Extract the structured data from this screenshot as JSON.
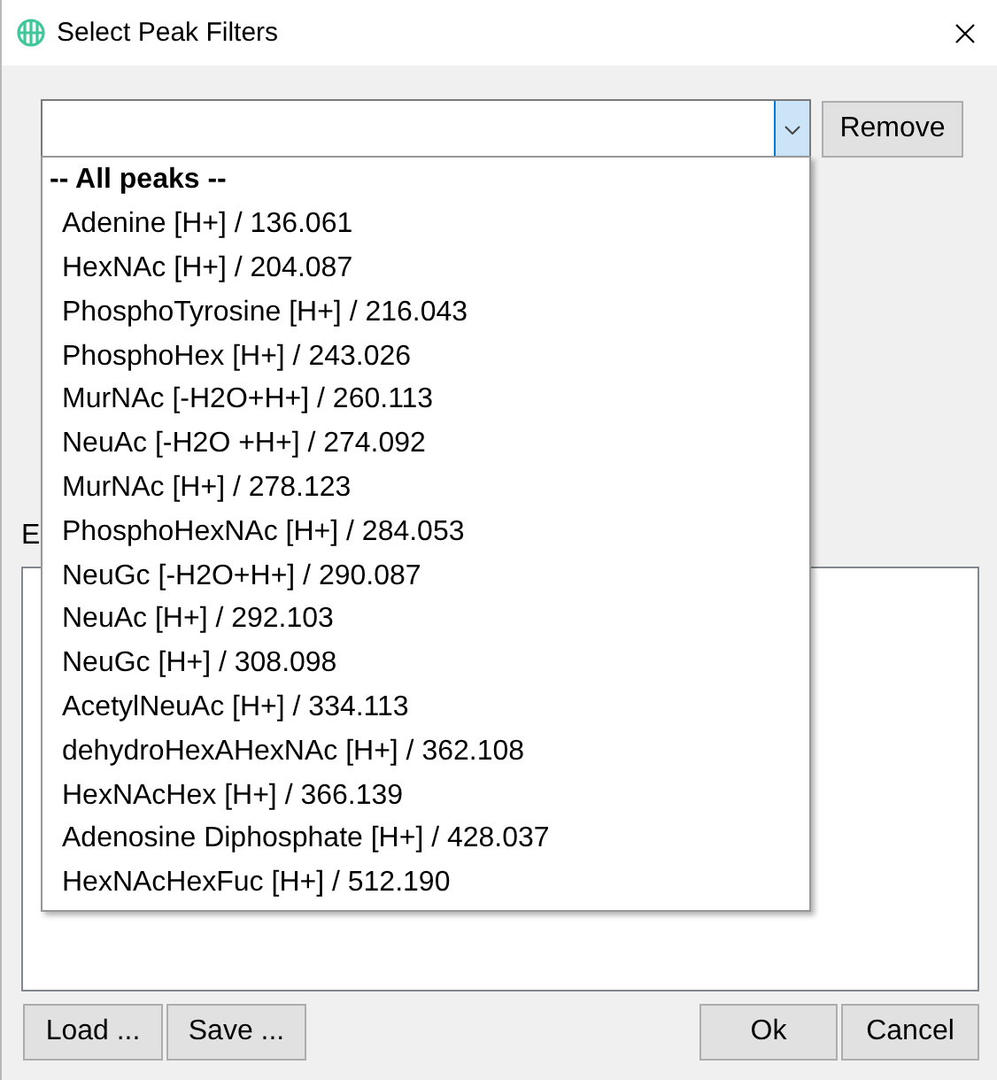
{
  "window": {
    "title": "Select Peak Filters"
  },
  "remove_button": "Remove",
  "list_label": "E",
  "dropdown": {
    "items": [
      {
        "label": "-- All peaks --",
        "kind": "header"
      },
      {
        "label": "Adenine [H+] / 136.061",
        "kind": "item"
      },
      {
        "label": "HexNAc [H+] / 204.087",
        "kind": "item"
      },
      {
        "label": "PhosphoTyrosine [H+] / 216.043",
        "kind": "item"
      },
      {
        "label": "PhosphoHex [H+] / 243.026",
        "kind": "item"
      },
      {
        "label": "MurNAc [-H2O+H+] / 260.113",
        "kind": "item"
      },
      {
        "label": "NeuAc [-H2O +H+] / 274.092",
        "kind": "item"
      },
      {
        "label": "MurNAc [H+] / 278.123",
        "kind": "item"
      },
      {
        "label": "PhosphoHexNAc [H+] / 284.053",
        "kind": "item"
      },
      {
        "label": "NeuGc [-H2O+H+] / 290.087",
        "kind": "item"
      },
      {
        "label": "NeuAc [H+] / 292.103",
        "kind": "item"
      },
      {
        "label": "NeuGc [H+] / 308.098",
        "kind": "item"
      },
      {
        "label": "AcetylNeuAc [H+] / 334.113",
        "kind": "item"
      },
      {
        "label": "dehydroHexAHexNAc [H+] / 362.108",
        "kind": "item"
      },
      {
        "label": "HexNAcHex [H+] / 366.139",
        "kind": "item"
      },
      {
        "label": "Adenosine Diphosphate [H+] / 428.037",
        "kind": "item"
      },
      {
        "label": "HexNAcHexFuc [H+] / 512.190",
        "kind": "item"
      }
    ]
  },
  "left_buttons": [
    "Load ...",
    "Save ..."
  ],
  "right_buttons": [
    "Ok",
    "Cancel"
  ]
}
